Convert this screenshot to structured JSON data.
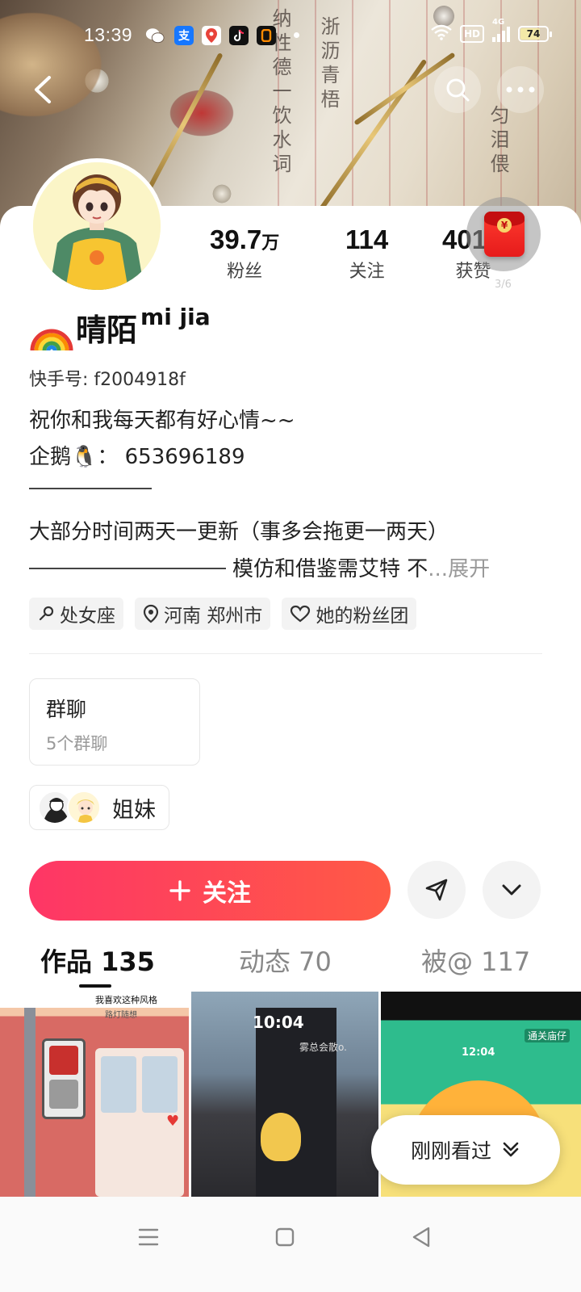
{
  "status_bar": {
    "time": "13:39",
    "apps": [
      {
        "icon": "wechat-icon",
        "color": "#2aae67"
      },
      {
        "icon": "alipay-icon",
        "label": "支",
        "color": "#1677ff"
      },
      {
        "icon": "map-pin-app-icon",
        "color": "#e8433a"
      },
      {
        "icon": "douyin-app-icon",
        "color": "#111111"
      },
      {
        "icon": "orange-app-icon",
        "color": "#111111"
      }
    ],
    "network_hd": "HD",
    "network_type": "4G",
    "battery": "74",
    "battery_level_percent": 74
  },
  "profile": {
    "stats": [
      {
        "value": "39.7",
        "unit": "万",
        "label": "粉丝"
      },
      {
        "value": "114",
        "unit": "",
        "label": "关注"
      },
      {
        "value": "401",
        "unit": "万",
        "label": "获赞"
      }
    ],
    "pager": "3/6",
    "name": "晴陌",
    "name_sup": "mi jia",
    "name_icon": "rainbow-icon",
    "kuaishou_id": "快手号: f2004918f",
    "bio_line1": "祝你和我每天都有好心情~~",
    "bio_line2": "企鹅🐧：  653696189",
    "bio_line3": "大部分时间两天一更新（事多会拖更一两天）",
    "bio_line4": "模仿和借鉴需艾特 不",
    "bio_more_ellipsis": "...",
    "bio_more_label": "展开",
    "tags": [
      {
        "icon": "zodiac-virgo-icon",
        "label": "处女座"
      },
      {
        "icon": "location-pin-icon",
        "label": "河南 郑州市"
      },
      {
        "icon": "heart-fan-icon",
        "label": "她的粉丝团"
      }
    ],
    "group_chat": {
      "title": "群聊",
      "subtitle": "5个群聊"
    },
    "sisters_label": "姐妹",
    "follow_label": "关注"
  },
  "tabs": [
    {
      "label": "作品 135",
      "active": true
    },
    {
      "label": "动态 70",
      "active": false
    },
    {
      "label": "被@ 117",
      "active": false
    }
  ],
  "thumbnails": {
    "t1_caption": "我喜欢这种风格",
    "t1_sub": "路灯随想",
    "t2_time": "10:04",
    "t2_caption": "雾总会散o.",
    "t3_time": "12:04",
    "t3_badge": "通关庙仔"
  },
  "recent_button": "刚刚看过",
  "colors": {
    "accent": "#fe3666",
    "accent_end": "#ff5a45",
    "redpacket": "#e61b1b"
  }
}
